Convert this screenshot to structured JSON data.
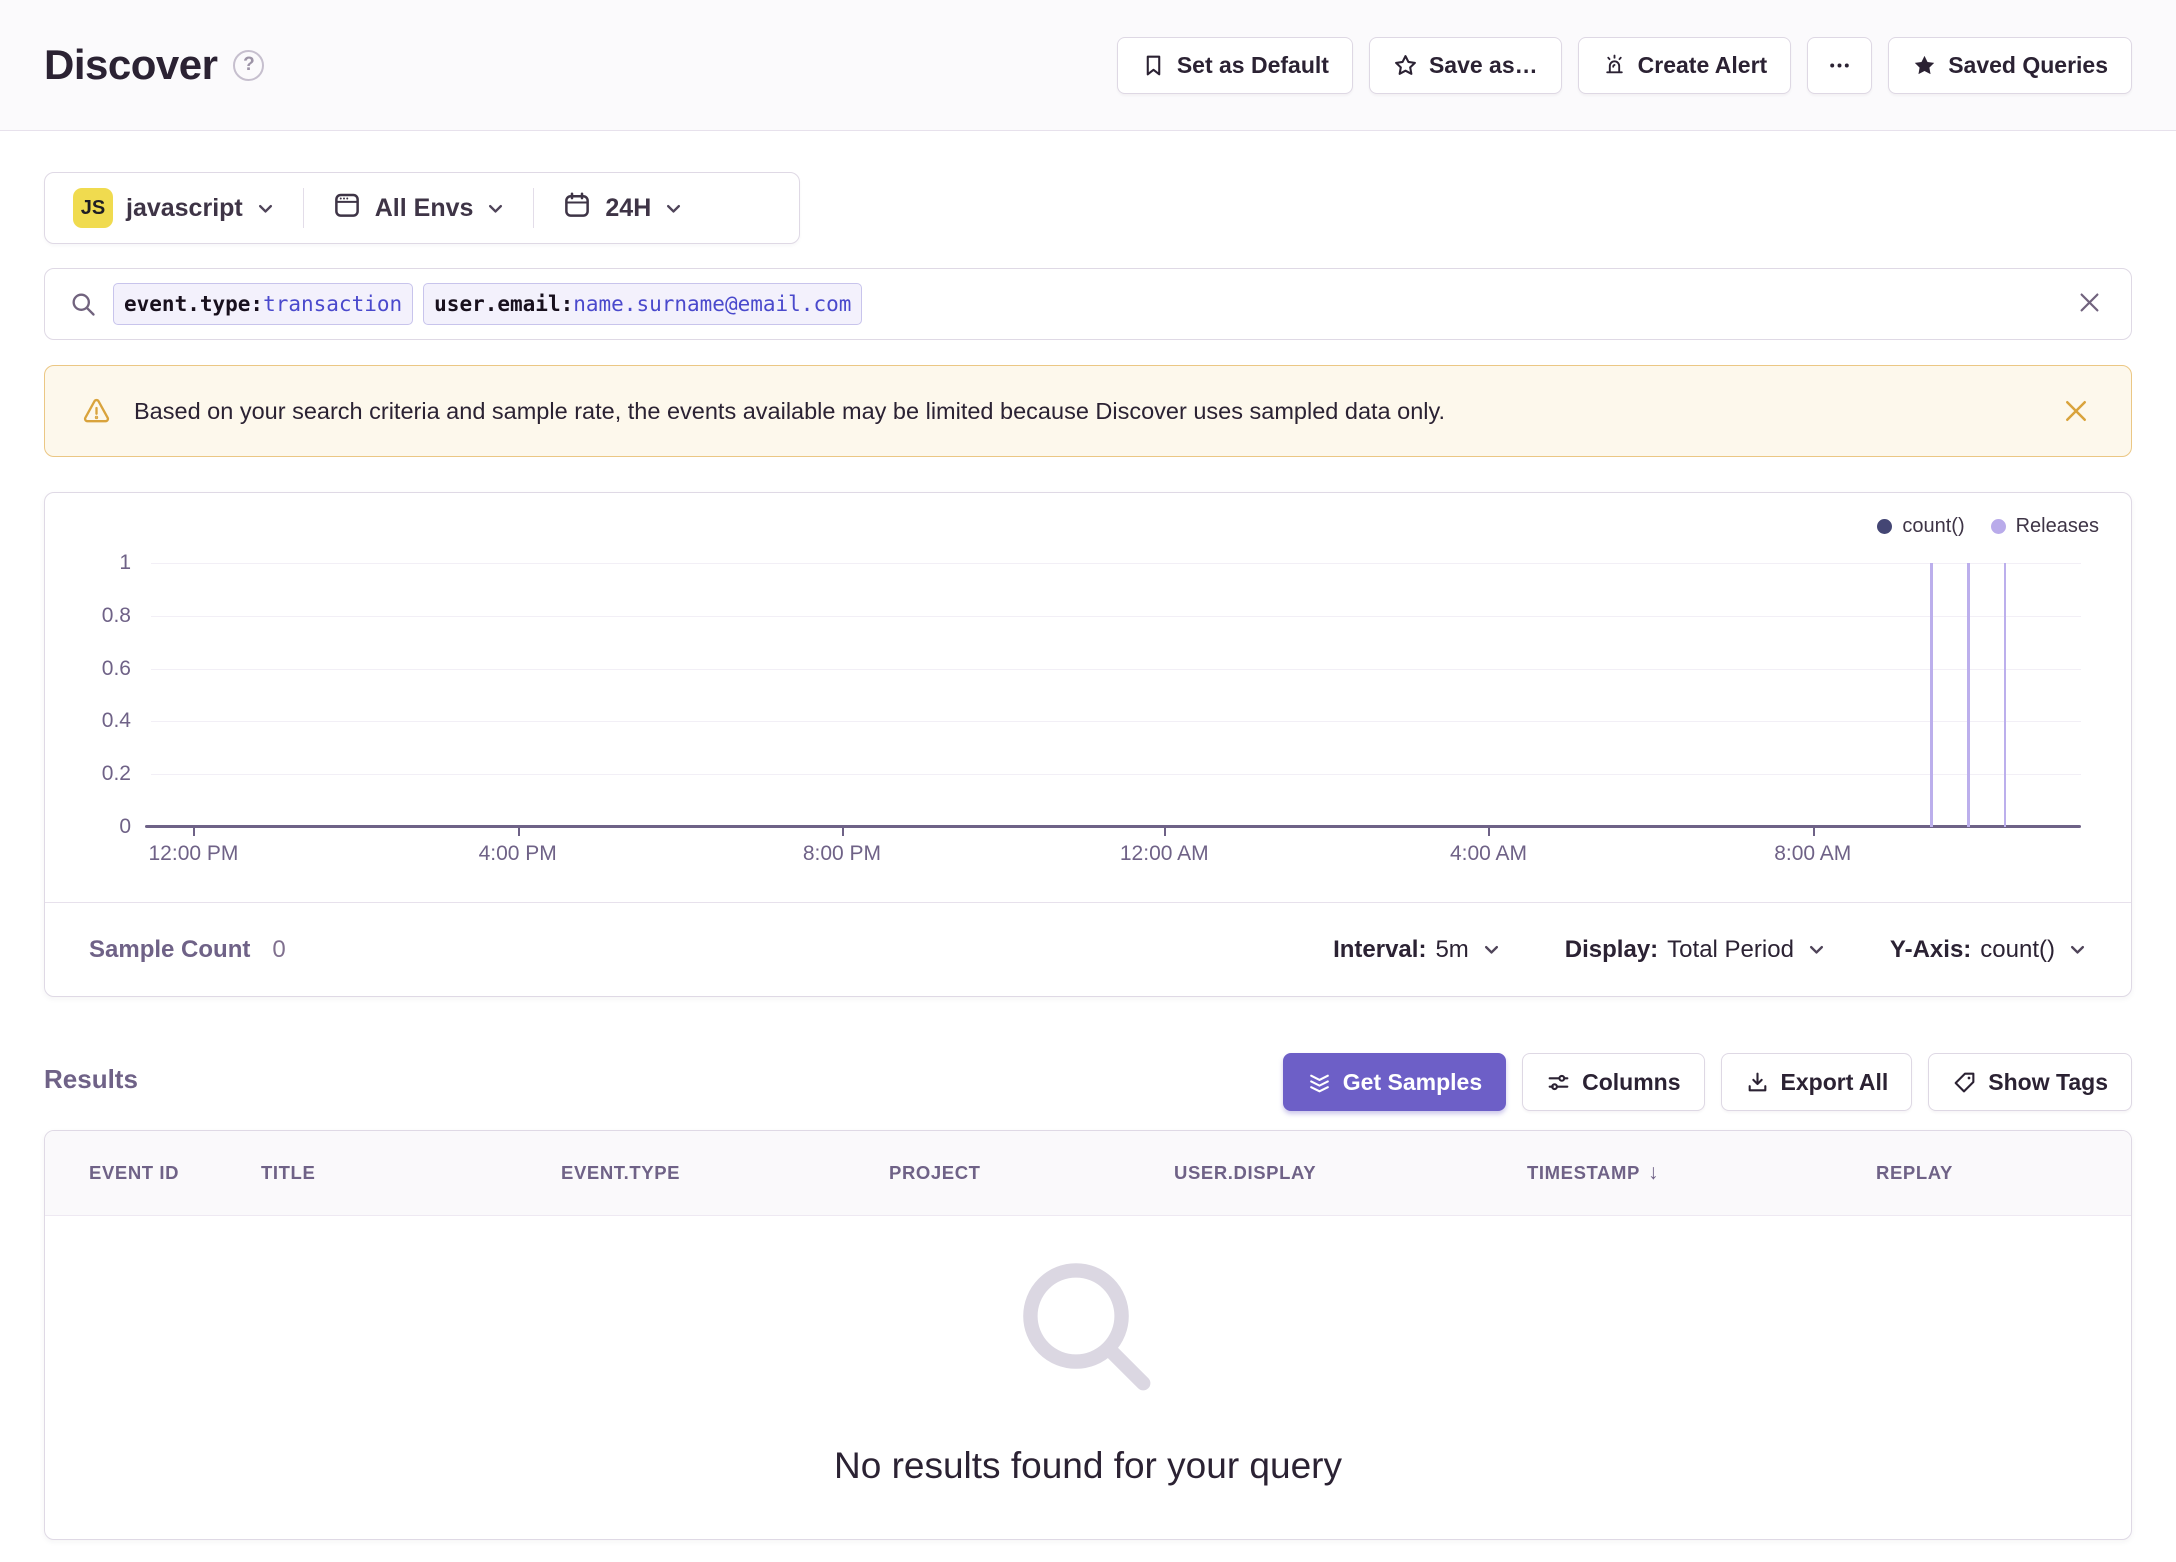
{
  "header": {
    "title": "Discover",
    "actions": [
      {
        "name": "set-as-default-button",
        "icon": "bookmark-icon",
        "label": "Set as Default"
      },
      {
        "name": "save-as-button",
        "icon": "star-outline-icon",
        "label": "Save as…"
      },
      {
        "name": "create-alert-button",
        "icon": "siren-icon",
        "label": "Create Alert"
      },
      {
        "name": "more-options-button",
        "icon": "ellipsis-icon",
        "label": ""
      },
      {
        "name": "saved-queries-button",
        "icon": "star-filled-icon",
        "label": "Saved Queries"
      }
    ]
  },
  "filters": {
    "project": {
      "badge": "JS",
      "label": "javascript"
    },
    "environment": {
      "label": "All Envs"
    },
    "date_range": {
      "label": "24H"
    }
  },
  "search": {
    "tokens": [
      {
        "key": "event.type:",
        "value": "transaction"
      },
      {
        "key": "user.email:",
        "value": "name.surname@email.com"
      }
    ]
  },
  "banner": {
    "text": "Based on your search criteria and sample rate, the events available may be limited because Discover uses sampled data only."
  },
  "chart_data": {
    "type": "line",
    "title": "",
    "xlabel": "",
    "ylabel": "",
    "ylim": [
      0,
      1
    ],
    "grid": true,
    "legend_position": "top-right",
    "y_ticks": [
      0,
      0.2,
      0.4,
      0.6,
      0.8,
      1
    ],
    "x_ticks": [
      {
        "label": "12:00 PM",
        "fraction": 0.022
      },
      {
        "label": "4:00 PM",
        "fraction": 0.19
      },
      {
        "label": "8:00 PM",
        "fraction": 0.358
      },
      {
        "label": "12:00 AM",
        "fraction": 0.525
      },
      {
        "label": "4:00 AM",
        "fraction": 0.693
      },
      {
        "label": "8:00 AM",
        "fraction": 0.861
      }
    ],
    "series": [
      {
        "name": "count()",
        "color": "#444674",
        "values": []
      }
    ],
    "releases": {
      "name": "Releases",
      "color": "#BCAFEC",
      "positions_fraction": [
        0.922,
        0.941,
        0.96
      ]
    },
    "legend": [
      {
        "label": "count()",
        "color": "#444674"
      },
      {
        "label": "Releases",
        "color": "#B9ABEA"
      }
    ]
  },
  "chart_footer": {
    "sample_count_label": "Sample Count",
    "sample_count_value": "0",
    "controls": [
      {
        "name": "interval-select",
        "label": "Interval:",
        "value": "5m"
      },
      {
        "name": "display-select",
        "label": "Display:",
        "value": "Total Period"
      },
      {
        "name": "yaxis-select",
        "label": "Y-Axis:",
        "value": "count()"
      }
    ]
  },
  "results": {
    "heading": "Results",
    "buttons": [
      {
        "name": "get-samples-button",
        "icon": "layers-icon",
        "label": "Get Samples",
        "primary": true
      },
      {
        "name": "columns-button",
        "icon": "sliders-icon",
        "label": "Columns"
      },
      {
        "name": "export-all-button",
        "icon": "download-icon",
        "label": "Export All"
      },
      {
        "name": "show-tags-button",
        "icon": "tag-icon",
        "label": "Show Tags"
      }
    ],
    "table": {
      "columns": [
        {
          "label": "EVENT ID"
        },
        {
          "label": "TITLE"
        },
        {
          "label": "EVENT.TYPE"
        },
        {
          "label": "PROJECT"
        },
        {
          "label": "USER.DISPLAY"
        },
        {
          "label": "TIMESTAMP",
          "sorted": "desc"
        },
        {
          "label": "REPLAY"
        }
      ],
      "rows": [],
      "empty_message": "No results found for your query"
    }
  },
  "icons": {
    "help-icon": "?",
    "sort-desc-icon": "↓"
  },
  "colors": {
    "accent": "#6C5FC7",
    "platform_badge": "#F0DB4F",
    "warning_bg": "#FDF8EC",
    "warning_border": "#EBC784",
    "warning_icon": "#D9A33C",
    "token_bg": "#F3F1FC",
    "token_value": "#4A49CC",
    "axis": "#6E6287"
  }
}
